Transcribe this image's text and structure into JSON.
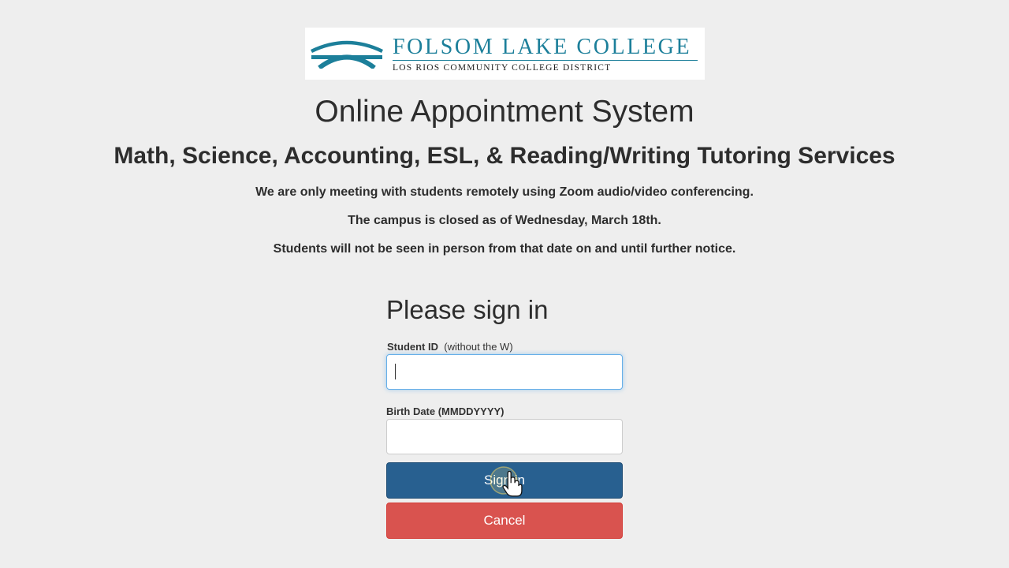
{
  "logo": {
    "title": "FOLSOM LAKE COLLEGE",
    "subtitle": "LOS RIOS COMMUNITY COLLEGE DISTRICT",
    "color": "#1c7f9a"
  },
  "header": {
    "title": "Online Appointment System",
    "subtitle": "Math, Science, Accounting, ESL, & Reading/Writing Tutoring Services"
  },
  "notices": [
    "We are only meeting with students remotely using Zoom audio/video conferencing.",
    "The campus is closed as of Wednesday, March 18th.",
    "Students will not be seen in person from that date on and until further notice."
  ],
  "signin": {
    "heading": "Please sign in",
    "student_id_label": "Student ID",
    "student_id_note": "(without the W)",
    "student_id_value": "",
    "birth_date_label": "Birth Date (MMDDYYYY)",
    "birth_date_value": "",
    "submit_label": "Sign in",
    "cancel_label": "Cancel"
  },
  "colors": {
    "primary": "#286090",
    "danger": "#d9534f",
    "background": "#eeeeee"
  },
  "icons": {
    "cursor": "hand-pointer-icon"
  }
}
